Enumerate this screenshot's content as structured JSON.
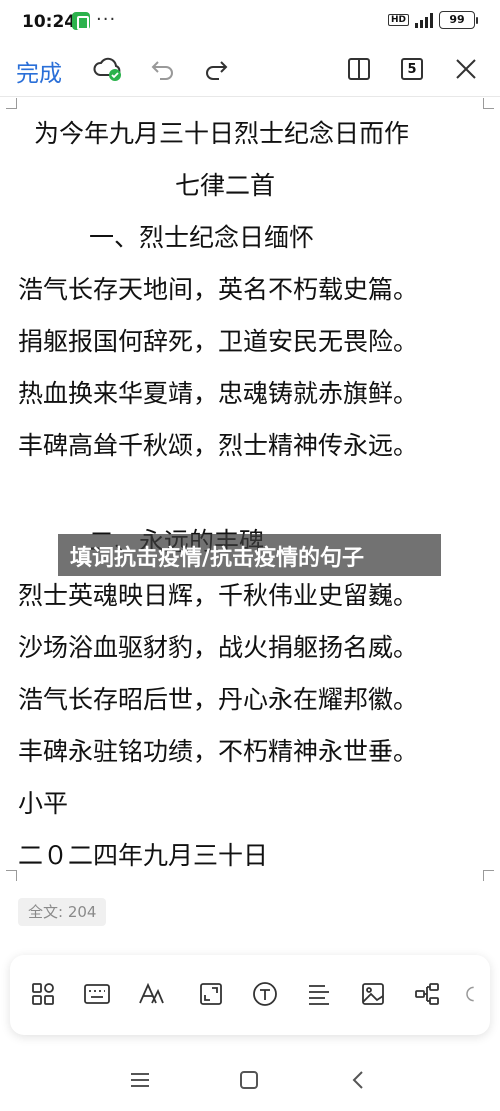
{
  "status": {
    "time": "10:24",
    "network": "HD",
    "battery": "99"
  },
  "toolbar": {
    "done_label": "完成",
    "page_count": "5"
  },
  "doc": {
    "lines": [
      "为今年九月三十日烈士纪念日而作",
      "七律二首",
      "一、烈士纪念日缅怀",
      "浩气长存天地间，英名不朽载史篇。",
      "捐躯报国何辞死，卫道安民无畏险。",
      "热血换来华夏靖，忠魂铸就赤旗鲜。",
      "丰碑高耸千秋颂，烈士精神传永远。",
      "二、永远的丰碑",
      "烈士英魂映日辉，千秋伟业史留巍。",
      "沙场浴血驱豺豹，战火捐躯扬名威。",
      "浩气长存昭后世，丹心永在耀邦徽。",
      "丰碑永驻铭功绩，不朽精神永世垂。",
      "小平",
      "二０二四年九月三十日"
    ]
  },
  "banner": {
    "text": "填词抗击疫情/抗击疫情的句子"
  },
  "footer": {
    "word_count": "全文: 204"
  },
  "colors": {
    "accent": "#2a6fd8",
    "sync_ok": "#2bb24c"
  }
}
